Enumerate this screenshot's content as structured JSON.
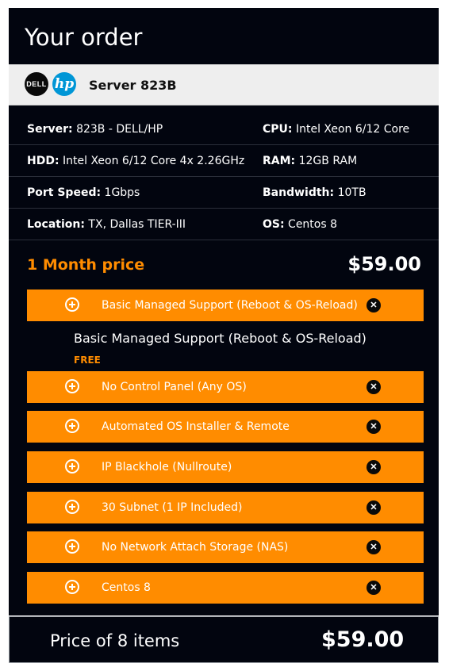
{
  "header": {
    "title": "Your order"
  },
  "product": {
    "dell_logo_text": "DELL",
    "hp_logo_text": "hp",
    "name": "Server 823B"
  },
  "specs": [
    {
      "left": {
        "key": "Server:",
        "value": "823B - DELL/HP"
      },
      "right": {
        "key": "CPU:",
        "value": "Intel Xeon 6/12 Core"
      }
    },
    {
      "left": {
        "key": "HDD:",
        "value": "Intel Xeon 6/12 Core 4x 2.26GHz"
      },
      "right": {
        "key": "RAM:",
        "value": "12GB RAM"
      }
    },
    {
      "left": {
        "key": "Port Speed:",
        "value": "1Gbps"
      },
      "right": {
        "key": "Bandwidth:",
        "value": "10TB"
      }
    },
    {
      "left": {
        "key": "Location:",
        "value": "TX, Dallas TIER-III"
      },
      "right": {
        "key": "OS:",
        "value": "Centos 8"
      }
    }
  ],
  "price": {
    "label": "1 Month price",
    "value": "$59.00"
  },
  "addons": [
    {
      "label": "Basic Managed Support (Reboot & OS-Reload)",
      "expanded_text": "Basic Managed Support (Reboot & OS-Reload)",
      "price_text": "FREE"
    },
    {
      "label": "No Control Panel (Any OS)"
    },
    {
      "label": "Automated OS Installer & Remote"
    },
    {
      "label": "IP Blackhole (Nullroute)"
    },
    {
      "label": "30 Subnet (1 IP Included)"
    },
    {
      "label": "No Network Attach Storage (NAS)"
    },
    {
      "label": "Centos 8"
    }
  ],
  "icons": {
    "add": "plus-circle-icon",
    "remove": "close-circle-icon"
  },
  "colors": {
    "accent": "#ff8c00",
    "panel": "#02050f",
    "hp_blue": "#0096d6"
  },
  "total": {
    "label": "Price of 8 items",
    "value": "$59.00"
  }
}
